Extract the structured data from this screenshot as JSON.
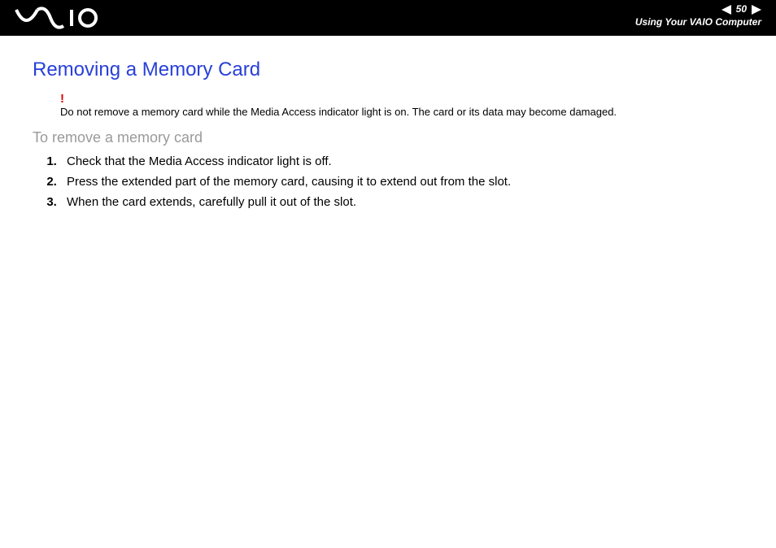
{
  "header": {
    "page_number": "50",
    "breadcrumb": "Using Your VAIO Computer"
  },
  "title": "Removing a Memory Card",
  "warning": {
    "mark": "!",
    "text_before": "Do not remove a memory card while the ",
    "text_media": "Media Access",
    "text_after": " indicator light is on. The card or its data may become damaged."
  },
  "subtitle": "To remove a memory card",
  "steps": [
    "Check that the Media Access indicator light is off.",
    "Press the extended part of the memory card, causing it to extend out from the slot.",
    "When the card extends, carefully pull it out of the slot."
  ]
}
